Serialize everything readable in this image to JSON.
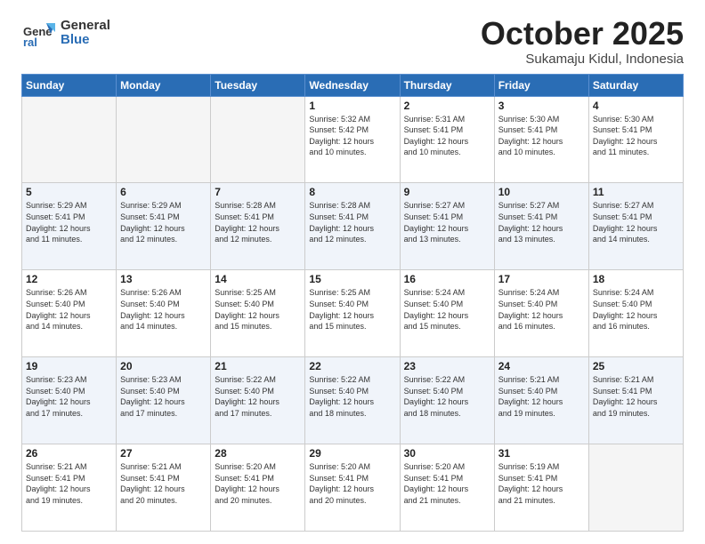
{
  "logo": {
    "general": "General",
    "blue": "Blue"
  },
  "title": "October 2025",
  "subtitle": "Sukamaju Kidul, Indonesia",
  "weekdays": [
    "Sunday",
    "Monday",
    "Tuesday",
    "Wednesday",
    "Thursday",
    "Friday",
    "Saturday"
  ],
  "weeks": [
    [
      {
        "day": "",
        "info": ""
      },
      {
        "day": "",
        "info": ""
      },
      {
        "day": "",
        "info": ""
      },
      {
        "day": "1",
        "info": "Sunrise: 5:32 AM\nSunset: 5:42 PM\nDaylight: 12 hours\nand 10 minutes."
      },
      {
        "day": "2",
        "info": "Sunrise: 5:31 AM\nSunset: 5:41 PM\nDaylight: 12 hours\nand 10 minutes."
      },
      {
        "day": "3",
        "info": "Sunrise: 5:30 AM\nSunset: 5:41 PM\nDaylight: 12 hours\nand 10 minutes."
      },
      {
        "day": "4",
        "info": "Sunrise: 5:30 AM\nSunset: 5:41 PM\nDaylight: 12 hours\nand 11 minutes."
      }
    ],
    [
      {
        "day": "5",
        "info": "Sunrise: 5:29 AM\nSunset: 5:41 PM\nDaylight: 12 hours\nand 11 minutes."
      },
      {
        "day": "6",
        "info": "Sunrise: 5:29 AM\nSunset: 5:41 PM\nDaylight: 12 hours\nand 12 minutes."
      },
      {
        "day": "7",
        "info": "Sunrise: 5:28 AM\nSunset: 5:41 PM\nDaylight: 12 hours\nand 12 minutes."
      },
      {
        "day": "8",
        "info": "Sunrise: 5:28 AM\nSunset: 5:41 PM\nDaylight: 12 hours\nand 12 minutes."
      },
      {
        "day": "9",
        "info": "Sunrise: 5:27 AM\nSunset: 5:41 PM\nDaylight: 12 hours\nand 13 minutes."
      },
      {
        "day": "10",
        "info": "Sunrise: 5:27 AM\nSunset: 5:41 PM\nDaylight: 12 hours\nand 13 minutes."
      },
      {
        "day": "11",
        "info": "Sunrise: 5:27 AM\nSunset: 5:41 PM\nDaylight: 12 hours\nand 14 minutes."
      }
    ],
    [
      {
        "day": "12",
        "info": "Sunrise: 5:26 AM\nSunset: 5:40 PM\nDaylight: 12 hours\nand 14 minutes."
      },
      {
        "day": "13",
        "info": "Sunrise: 5:26 AM\nSunset: 5:40 PM\nDaylight: 12 hours\nand 14 minutes."
      },
      {
        "day": "14",
        "info": "Sunrise: 5:25 AM\nSunset: 5:40 PM\nDaylight: 12 hours\nand 15 minutes."
      },
      {
        "day": "15",
        "info": "Sunrise: 5:25 AM\nSunset: 5:40 PM\nDaylight: 12 hours\nand 15 minutes."
      },
      {
        "day": "16",
        "info": "Sunrise: 5:24 AM\nSunset: 5:40 PM\nDaylight: 12 hours\nand 15 minutes."
      },
      {
        "day": "17",
        "info": "Sunrise: 5:24 AM\nSunset: 5:40 PM\nDaylight: 12 hours\nand 16 minutes."
      },
      {
        "day": "18",
        "info": "Sunrise: 5:24 AM\nSunset: 5:40 PM\nDaylight: 12 hours\nand 16 minutes."
      }
    ],
    [
      {
        "day": "19",
        "info": "Sunrise: 5:23 AM\nSunset: 5:40 PM\nDaylight: 12 hours\nand 17 minutes."
      },
      {
        "day": "20",
        "info": "Sunrise: 5:23 AM\nSunset: 5:40 PM\nDaylight: 12 hours\nand 17 minutes."
      },
      {
        "day": "21",
        "info": "Sunrise: 5:22 AM\nSunset: 5:40 PM\nDaylight: 12 hours\nand 17 minutes."
      },
      {
        "day": "22",
        "info": "Sunrise: 5:22 AM\nSunset: 5:40 PM\nDaylight: 12 hours\nand 18 minutes."
      },
      {
        "day": "23",
        "info": "Sunrise: 5:22 AM\nSunset: 5:40 PM\nDaylight: 12 hours\nand 18 minutes."
      },
      {
        "day": "24",
        "info": "Sunrise: 5:21 AM\nSunset: 5:40 PM\nDaylight: 12 hours\nand 19 minutes."
      },
      {
        "day": "25",
        "info": "Sunrise: 5:21 AM\nSunset: 5:41 PM\nDaylight: 12 hours\nand 19 minutes."
      }
    ],
    [
      {
        "day": "26",
        "info": "Sunrise: 5:21 AM\nSunset: 5:41 PM\nDaylight: 12 hours\nand 19 minutes."
      },
      {
        "day": "27",
        "info": "Sunrise: 5:21 AM\nSunset: 5:41 PM\nDaylight: 12 hours\nand 20 minutes."
      },
      {
        "day": "28",
        "info": "Sunrise: 5:20 AM\nSunset: 5:41 PM\nDaylight: 12 hours\nand 20 minutes."
      },
      {
        "day": "29",
        "info": "Sunrise: 5:20 AM\nSunset: 5:41 PM\nDaylight: 12 hours\nand 20 minutes."
      },
      {
        "day": "30",
        "info": "Sunrise: 5:20 AM\nSunset: 5:41 PM\nDaylight: 12 hours\nand 21 minutes."
      },
      {
        "day": "31",
        "info": "Sunrise: 5:19 AM\nSunset: 5:41 PM\nDaylight: 12 hours\nand 21 minutes."
      },
      {
        "day": "",
        "info": ""
      }
    ]
  ]
}
